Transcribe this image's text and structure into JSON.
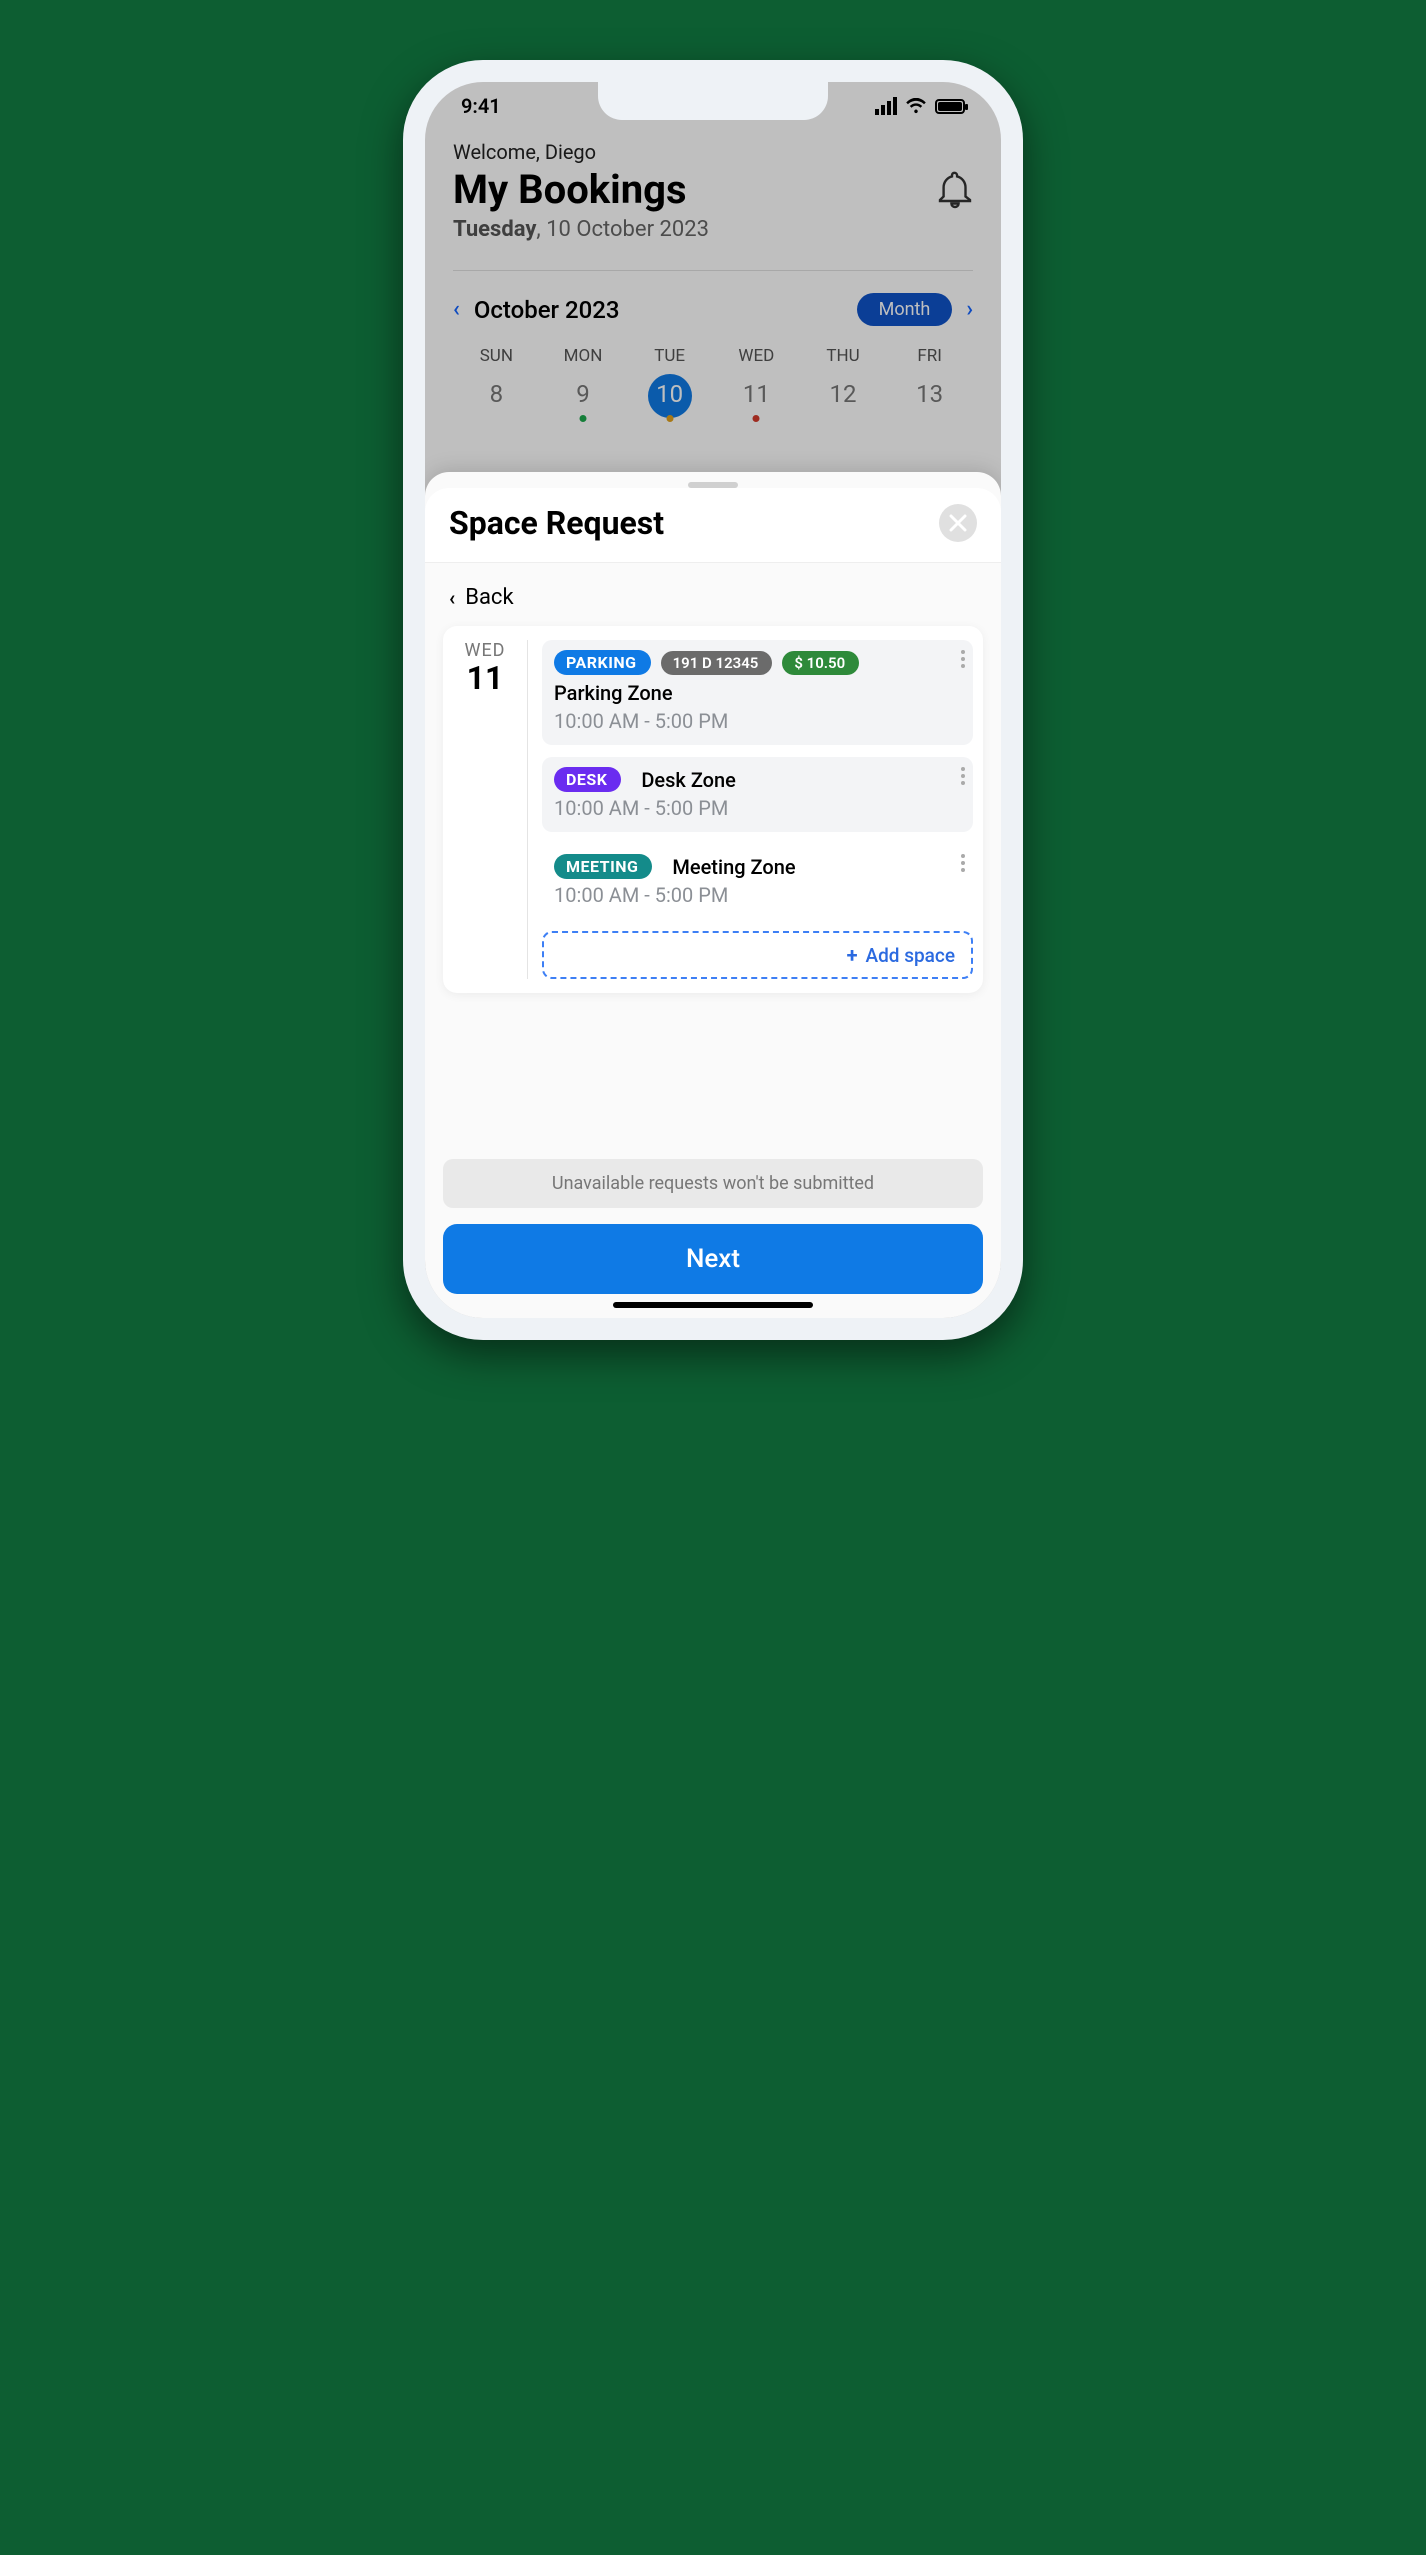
{
  "status": {
    "time": "9:41"
  },
  "header": {
    "welcome": "Welcome, Diego",
    "title": "My Bookings",
    "weekday": "Tuesday",
    "date_rest": ", 10 October 2023"
  },
  "calendar": {
    "month_label": "October 2023",
    "view_toggle": "Month",
    "weekdays": [
      "SUN",
      "MON",
      "TUE",
      "WED",
      "THU",
      "FRI"
    ],
    "days": [
      {
        "num": "8",
        "dot": null,
        "active": false
      },
      {
        "num": "9",
        "dot": "green",
        "active": false
      },
      {
        "num": "10",
        "dot": "orange",
        "active": true
      },
      {
        "num": "11",
        "dot": "red",
        "active": false
      },
      {
        "num": "12",
        "dot": null,
        "active": false
      },
      {
        "num": "13",
        "dot": null,
        "active": false
      }
    ]
  },
  "sheet": {
    "title": "Space Request",
    "back_label": "Back",
    "day": {
      "weekday": "WED",
      "num": "11"
    },
    "entries": [
      {
        "kind": "PARKING",
        "kind_color": "park",
        "plate": "191 D 12345",
        "price": "$ 10.50",
        "zone": "Parking Zone",
        "time": "10:00 AM - 5:00 PM",
        "bg": true,
        "inline_zone": false
      },
      {
        "kind": "DESK",
        "kind_color": "desk",
        "plate": null,
        "price": null,
        "zone": "Desk Zone",
        "time": "10:00 AM - 5:00 PM",
        "bg": true,
        "inline_zone": true
      },
      {
        "kind": "MEETING",
        "kind_color": "meet",
        "plate": null,
        "price": null,
        "zone": "Meeting Zone",
        "time": "10:00 AM - 5:00 PM",
        "bg": false,
        "inline_zone": true
      }
    ],
    "add_space_label": "Add space",
    "note": "Unavailable requests won't be submitted",
    "next_label": "Next"
  }
}
